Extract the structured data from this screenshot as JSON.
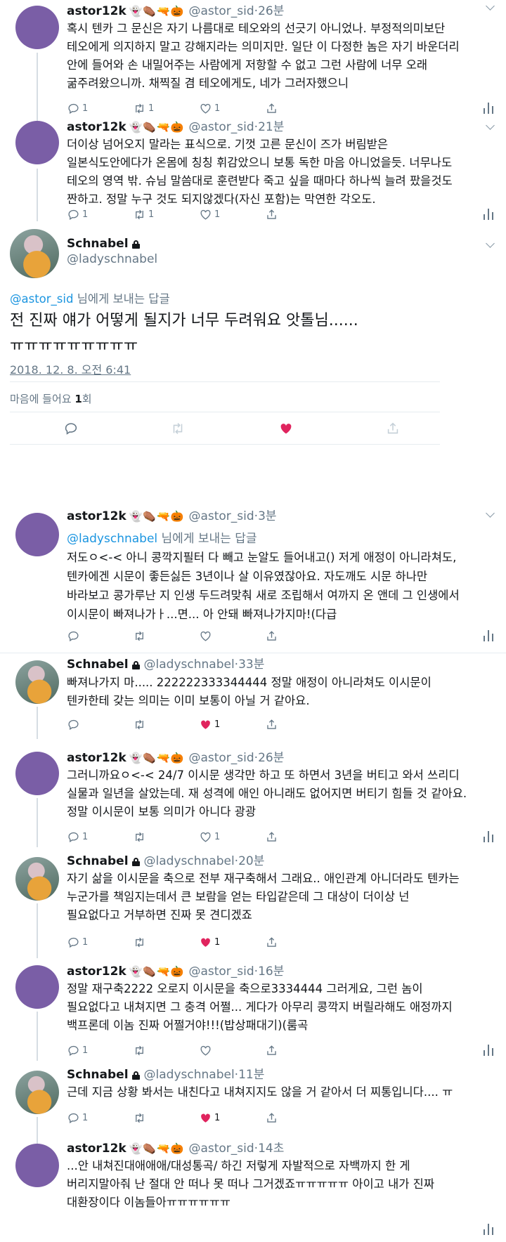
{
  "emoji": "👻⚰️🔫🎃",
  "tweets": [
    {
      "name": "astor12k",
      "handle": "@astor_sid",
      "time": "26분",
      "lines": [
        "혹시 텐카 그 문신은 자기 나름대로 테오와의 선긋기 아니었나. 부정적의미보단",
        "테오에게 의지하지 말고 강해지라는 의미지만. 일단 이 다정한 놈은 자기 바운더리",
        "안에 들어와 손 내밀어주는 사람에게 저항할 수 없고 그런 사람에 너무 오래",
        "굶주려왔으니까. 채찍질 겸 테오에게도, 네가 그러자했으니"
      ],
      "reply_count": "1",
      "rt_count": "1",
      "like_count": "1"
    },
    {
      "name": "astor12k",
      "handle": "@astor_sid",
      "time": "21분",
      "lines": [
        "더이상 넘어오지 말라는 표식으로. 기껏 고른 문신이 즈가 버림받은",
        "일본식도안에다가 온몸에 칭칭 휘감았으니 보통 독한 마음 아니었을듯. 너무나도",
        "테오의 영역 밖. 슈님 말씀대로 훈련받다 죽고 싶을 때마다 하나씩 늘려 팠을것도",
        "짠하고. 정말 누구 것도 되지않겠다(자신 포함)는 막연한 각오도."
      ],
      "reply_count": "1",
      "rt_count": "1",
      "like_count": "1"
    }
  ],
  "main": {
    "name": "Schnabel",
    "handle": "@ladyschnabel",
    "reply_to_handle": "@astor_sid",
    "reply_to_suffix": " 님에게 보내는 답글",
    "line1": "전 진짜 얘가 어떻게 될지가 너무 두려워요 앗톨님......",
    "line2": "ㅠㅠㅠㅠㅠㅠㅠㅠㅠ",
    "datetime": "2018. 12. 8. 오전 6:41",
    "likes_prefix": "마음에 들어요 ",
    "likes_count": "1",
    "likes_suffix": "회"
  },
  "replies": [
    {
      "name": "astor12k",
      "handle": "@astor_sid",
      "time": "3분",
      "reply_to": "@ladyschnabel",
      "reply_suffix": " 님에게 보내는 답글",
      "lines": [
        "저도ㅇ<-< 아니 콩깍지필터 다 빼고 눈알도 들어내고() 저게 애정이 아니라쳐도,",
        "텐카에겐 시문이 좋든싫든 3년이나 살 이유였잖아요. 자도깨도 시문 하나만",
        "바라보고 콩가루난 지 인생 두드려맞춰 새로 조립해서 여까지 온 앤데 그 인생에서",
        "이시문이 빠져나가ㅏ...면... 아 안돼 빠져나가지마!(다급"
      ]
    },
    {
      "name": "Schnabel",
      "handle": "@ladyschnabel",
      "time": "33분",
      "lines": [
        "빠져나가지 마..... 222222333344444 정말 애정이 아니라쳐도 이시문이",
        "텐카한테 갖는 의미는 이미 보통이 아닐 거 같아요."
      ],
      "like_count": "1"
    },
    {
      "name": "astor12k",
      "handle": "@astor_sid",
      "time": "26분",
      "lines": [
        "그러니까요ㅇ<-< 24/7 이시문 생각만 하고 또 하면서 3년을 버티고 와서 쓰리디",
        "실물과 일년을 살았는데. 재 성격에 애인 아니래도 없어지면 버티기 힘들 것 같아요.",
        "정말 이시문이 보통 의미가 아니다 광광"
      ],
      "reply_count": "1",
      "like_count": "1"
    },
    {
      "name": "Schnabel",
      "handle": "@ladyschnabel",
      "time": "20분",
      "lines": [
        "자기 삶을 이시문을 축으로 전부 재구축해서 그래요.. 애인관계 아니더라도 텐카는",
        "누군가를 책임지는데서 큰 보람을 얻는 타입같은데 그 대상이 더이상 넌",
        "필요없다고 거부하면 진짜 못 견디겠죠"
      ],
      "reply_count": "1",
      "like_count": "1"
    },
    {
      "name": "astor12k",
      "handle": "@astor_sid",
      "time": "16분",
      "lines": [
        "정말 재구축2222 오로지 이시문을 축으로3334444 그러게요, 그런 놈이",
        "필요없다고 내쳐지면 그 충격 어쩔... 게다가 아무리 콩깍지 버릴라해도 애정까지",
        "백프론데 이놈 진짜 어쩔거야!!!(밥상패대기)(룸곡"
      ],
      "reply_count": "1"
    },
    {
      "name": "Schnabel",
      "handle": "@ladyschnabel",
      "time": "11분",
      "lines": [
        "근데 지금 상황 봐서는 내친다고 내쳐지지도 않을 거 같아서 더 찌통입니다.... ㅠ"
      ],
      "reply_count": "1",
      "like_count": "1"
    },
    {
      "name": "astor12k",
      "handle": "@astor_sid",
      "time": "14초",
      "lines": [
        "...안 내쳐진대애애애/대성통곡/ 하긴 저렇게 자발적으로 자백까지 한 게",
        "버리지말아줘 난 절대 안 떠나 못 떠나 그거겠죠ㅠㅠㅠㅠㅠ 아이고 내가 진짜",
        "대환장이다 이놈들아ㅠㅠㅠㅠㅠㅠ"
      ]
    }
  ],
  "colors": {
    "link": "#1b95e0",
    "heart": "#e0245e",
    "muted": "#657786",
    "avatar": "#7a5ea6"
  }
}
